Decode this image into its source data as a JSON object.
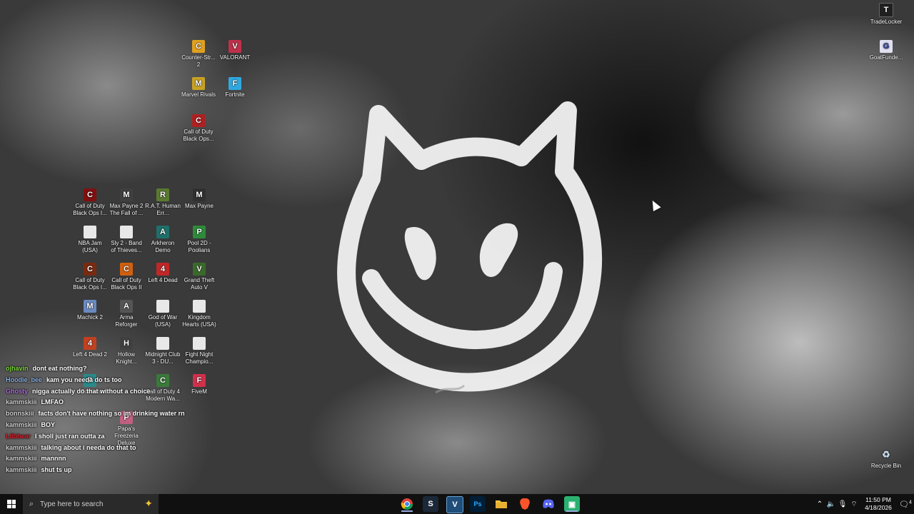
{
  "desktop_icons": [
    {
      "id": "cs2",
      "label": "Counter-Str... 2",
      "color": "#e0a020",
      "glyph": "C"
    },
    {
      "id": "valorant",
      "label": "VALORANT",
      "color": "#c0304a",
      "glyph": "V"
    },
    {
      "id": "marvel",
      "label": "Marvel Rivals",
      "color": "#c9a224",
      "glyph": "M"
    },
    {
      "id": "fortnite",
      "label": "Fortnite",
      "color": "#2fa8e0",
      "glyph": "F"
    },
    {
      "id": "cod-bo",
      "label": "Call of Duty Black Ops...",
      "color": "#b02020",
      "glyph": "C"
    },
    {
      "id": "cod-bo1",
      "label": "Call of Duty Black Ops I...",
      "color": "#801010",
      "glyph": "C"
    },
    {
      "id": "maxpayne2",
      "label": "Max Payne 2 The Fall of ...",
      "color": "#404040",
      "glyph": "M"
    },
    {
      "id": "rat",
      "label": "R.A.T. Human Err...",
      "color": "#5a7a30",
      "glyph": "R"
    },
    {
      "id": "maxpayne",
      "label": "Max Payne",
      "color": "#303030",
      "glyph": "M"
    },
    {
      "id": "nbajam",
      "label": "NBA Jam (USA)",
      "color": "#e8e8e8",
      "glyph": ""
    },
    {
      "id": "sly2",
      "label": "Sly 2 - Band of Thieves...",
      "color": "#e8e8e8",
      "glyph": ""
    },
    {
      "id": "arkheron",
      "label": "Arkheron Demo",
      "color": "#1f6f6a",
      "glyph": "A"
    },
    {
      "id": "pool2d",
      "label": "Pool 2D - Poolians",
      "color": "#2e8a3a",
      "glyph": "P"
    },
    {
      "id": "cod-bo1b",
      "label": "Call of Duty Black Ops I...",
      "color": "#7a2a10",
      "glyph": "C"
    },
    {
      "id": "cod-bo2",
      "label": "Call of Duty Black Ops II",
      "color": "#d06010",
      "glyph": "C"
    },
    {
      "id": "l4d",
      "label": "Left 4 Dead",
      "color": "#c02828",
      "glyph": "4"
    },
    {
      "id": "gtav",
      "label": "Grand Theft Auto V",
      "color": "#3a6a2a",
      "glyph": "V"
    },
    {
      "id": "machick2",
      "label": "Machick 2",
      "color": "#6a8ac0",
      "glyph": "M"
    },
    {
      "id": "arma",
      "label": "Arma Reforger",
      "color": "#555555",
      "glyph": "A"
    },
    {
      "id": "gow",
      "label": "God of War (USA)",
      "color": "#e8e8e8",
      "glyph": ""
    },
    {
      "id": "kh",
      "label": "Kingdom Hearts (USA)",
      "color": "#e8e8e8",
      "glyph": ""
    },
    {
      "id": "l4d2",
      "label": "Left 4 Dead 2",
      "color": "#c04020",
      "glyph": "4"
    },
    {
      "id": "hollow",
      "label": "Hollow Knight...",
      "color": "#404040",
      "glyph": "H"
    },
    {
      "id": "midnight",
      "label": "Midnight Club 3 - DU...",
      "color": "#e8e8e8",
      "glyph": ""
    },
    {
      "id": "fightnight",
      "label": "Fight Night Champio...",
      "color": "#e8e8e8",
      "glyph": ""
    },
    {
      "id": "pool-b",
      "label": "- Poolians",
      "color": "#2a8a8a",
      "glyph": "P"
    },
    {
      "id": "cod4",
      "label": "Call of Duty 4 Modern Wa...",
      "color": "#3a7a3a",
      "glyph": "C"
    },
    {
      "id": "fivem",
      "label": "FiveM",
      "color": "#d0304a",
      "glyph": "F"
    },
    {
      "id": "papas",
      "label": "Papa's Freezeria Deluxe",
      "color": "#c06080",
      "glyph": "P"
    },
    {
      "id": "tradelocker",
      "label": "TradeLocker",
      "color": "#202020",
      "glyph": "T"
    },
    {
      "id": "goatfunded",
      "label": "GoatFunde...",
      "color": "#e0e0f0",
      "glyph": "G"
    },
    {
      "id": "recycle",
      "label": "Recycle Bin",
      "color": "#8aa8c8",
      "glyph": "♻"
    }
  ],
  "chat": [
    {
      "user": "ojhavin",
      "user_color": "#7bd63a",
      "msg": "dont eat nothing?"
    },
    {
      "user": "Hoodie_bee",
      "user_color": "#8ab0e0",
      "msg": "kam you needa do ts too"
    },
    {
      "user": "Ghosty",
      "user_color": "#b070e0",
      "msg": "nigga actually do that without a choice"
    },
    {
      "user": "kammskiii",
      "user_color": "#d0d0d0",
      "msg": "LMFAO"
    },
    {
      "user": "bonnskiii",
      "user_color": "#d0d0d0",
      "msg": "facts don't have nothing so im drinking water rn"
    },
    {
      "user": "kammskiii",
      "user_color": "#d0d0d0",
      "msg": "BOY"
    },
    {
      "user": "Lilbbear",
      "user_color": "#e02030",
      "msg": "I sholl just ran outta za"
    },
    {
      "user": "kammskiii",
      "user_color": "#d0d0d0",
      "msg": "talking about i needa do that to"
    },
    {
      "user": "kammskiii",
      "user_color": "#d0d0d0",
      "msg": "mannnn"
    },
    {
      "user": "kammskiii",
      "user_color": "#d0d0d0",
      "msg": "shut ts up"
    }
  ],
  "taskbar": {
    "search_placeholder": "Type here to search",
    "apps": [
      {
        "name": "chrome",
        "color": "#e04030",
        "glyph": "◉"
      },
      {
        "name": "steam",
        "color": "#1b2838",
        "glyph": "S"
      },
      {
        "name": "vscode-v",
        "color": "#1f4e7a",
        "glyph": "V"
      },
      {
        "name": "photoshop",
        "color": "#001e36",
        "glyph": "Ps"
      },
      {
        "name": "file-explorer",
        "color": "#e0b020",
        "glyph": "▬"
      },
      {
        "name": "brave",
        "color": "#e05020",
        "glyph": "B"
      },
      {
        "name": "discord",
        "color": "#5865f2",
        "glyph": "◕"
      },
      {
        "name": "app-green",
        "color": "#2ab070",
        "glyph": "▣"
      }
    ],
    "time": "11:50 PM",
    "date": "4/18/2026",
    "notification_count": "4"
  }
}
